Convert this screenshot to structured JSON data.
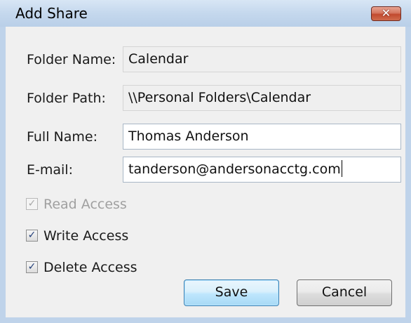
{
  "window": {
    "title": "Add Share",
    "close_glyph": "✕"
  },
  "form": {
    "folder_name": {
      "label": "Folder Name:",
      "value": "Calendar"
    },
    "folder_path": {
      "label": "Folder Path:",
      "value": "\\\\Personal Folders\\Calendar"
    },
    "full_name": {
      "label": "Full Name:",
      "value": "Thomas Anderson"
    },
    "email": {
      "label": "E-mail:",
      "value": "tanderson@andersonacctg.com"
    }
  },
  "permissions": {
    "read": {
      "label": "Read Access",
      "checked": true,
      "enabled": false,
      "check_glyph": "✓"
    },
    "write": {
      "label": "Write Access",
      "checked": true,
      "enabled": true,
      "check_glyph": "✓"
    },
    "delete": {
      "label": "Delete Access",
      "checked": true,
      "enabled": true,
      "check_glyph": "✓"
    }
  },
  "buttons": {
    "save": "Save",
    "cancel": "Cancel"
  },
  "icons": {
    "close": "close-icon",
    "checkmark": "checkmark-icon"
  },
  "colors": {
    "frame": "#bfd3ea",
    "client_background": "#f0f0f0",
    "close_button": "#c24a2f",
    "default_button_border": "#3c7fb1",
    "disabled_text": "#a0a0a0"
  }
}
